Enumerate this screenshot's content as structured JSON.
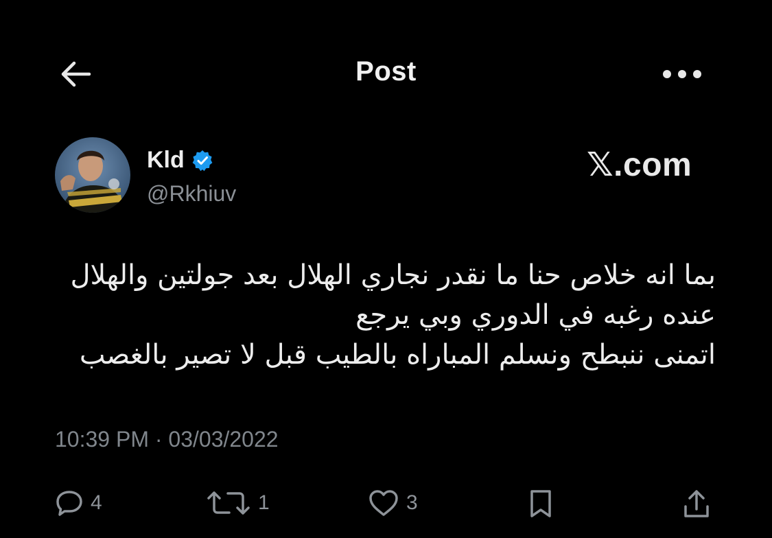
{
  "header": {
    "title": "Post",
    "back_icon": "arrow-left-icon",
    "more_icon": "more-horizontal-icon"
  },
  "author": {
    "display_name": "Kld",
    "handle": "@Rkhiuv",
    "verified": true,
    "verified_color": "#1d9bf0"
  },
  "watermark": "𝕏.com",
  "post": {
    "lines": [
      "بما انه خلاص حنا ما نقدر نجاري الهلال بعد جولتين والهلال",
      "عنده رغبه في الدوري وبي يرجع",
      "اتمنى ننبطح ونسلم المباراه بالطيب قبل لا تصير بالغصب"
    ],
    "timestamp": "10:39 PM · 03/03/2022"
  },
  "actions": {
    "reply_count": "4",
    "repost_count": "1",
    "like_count": "3"
  },
  "colors": {
    "background": "#000000",
    "text": "#e7e9ea",
    "muted": "#8b9096",
    "accent": "#1d9bf0"
  }
}
